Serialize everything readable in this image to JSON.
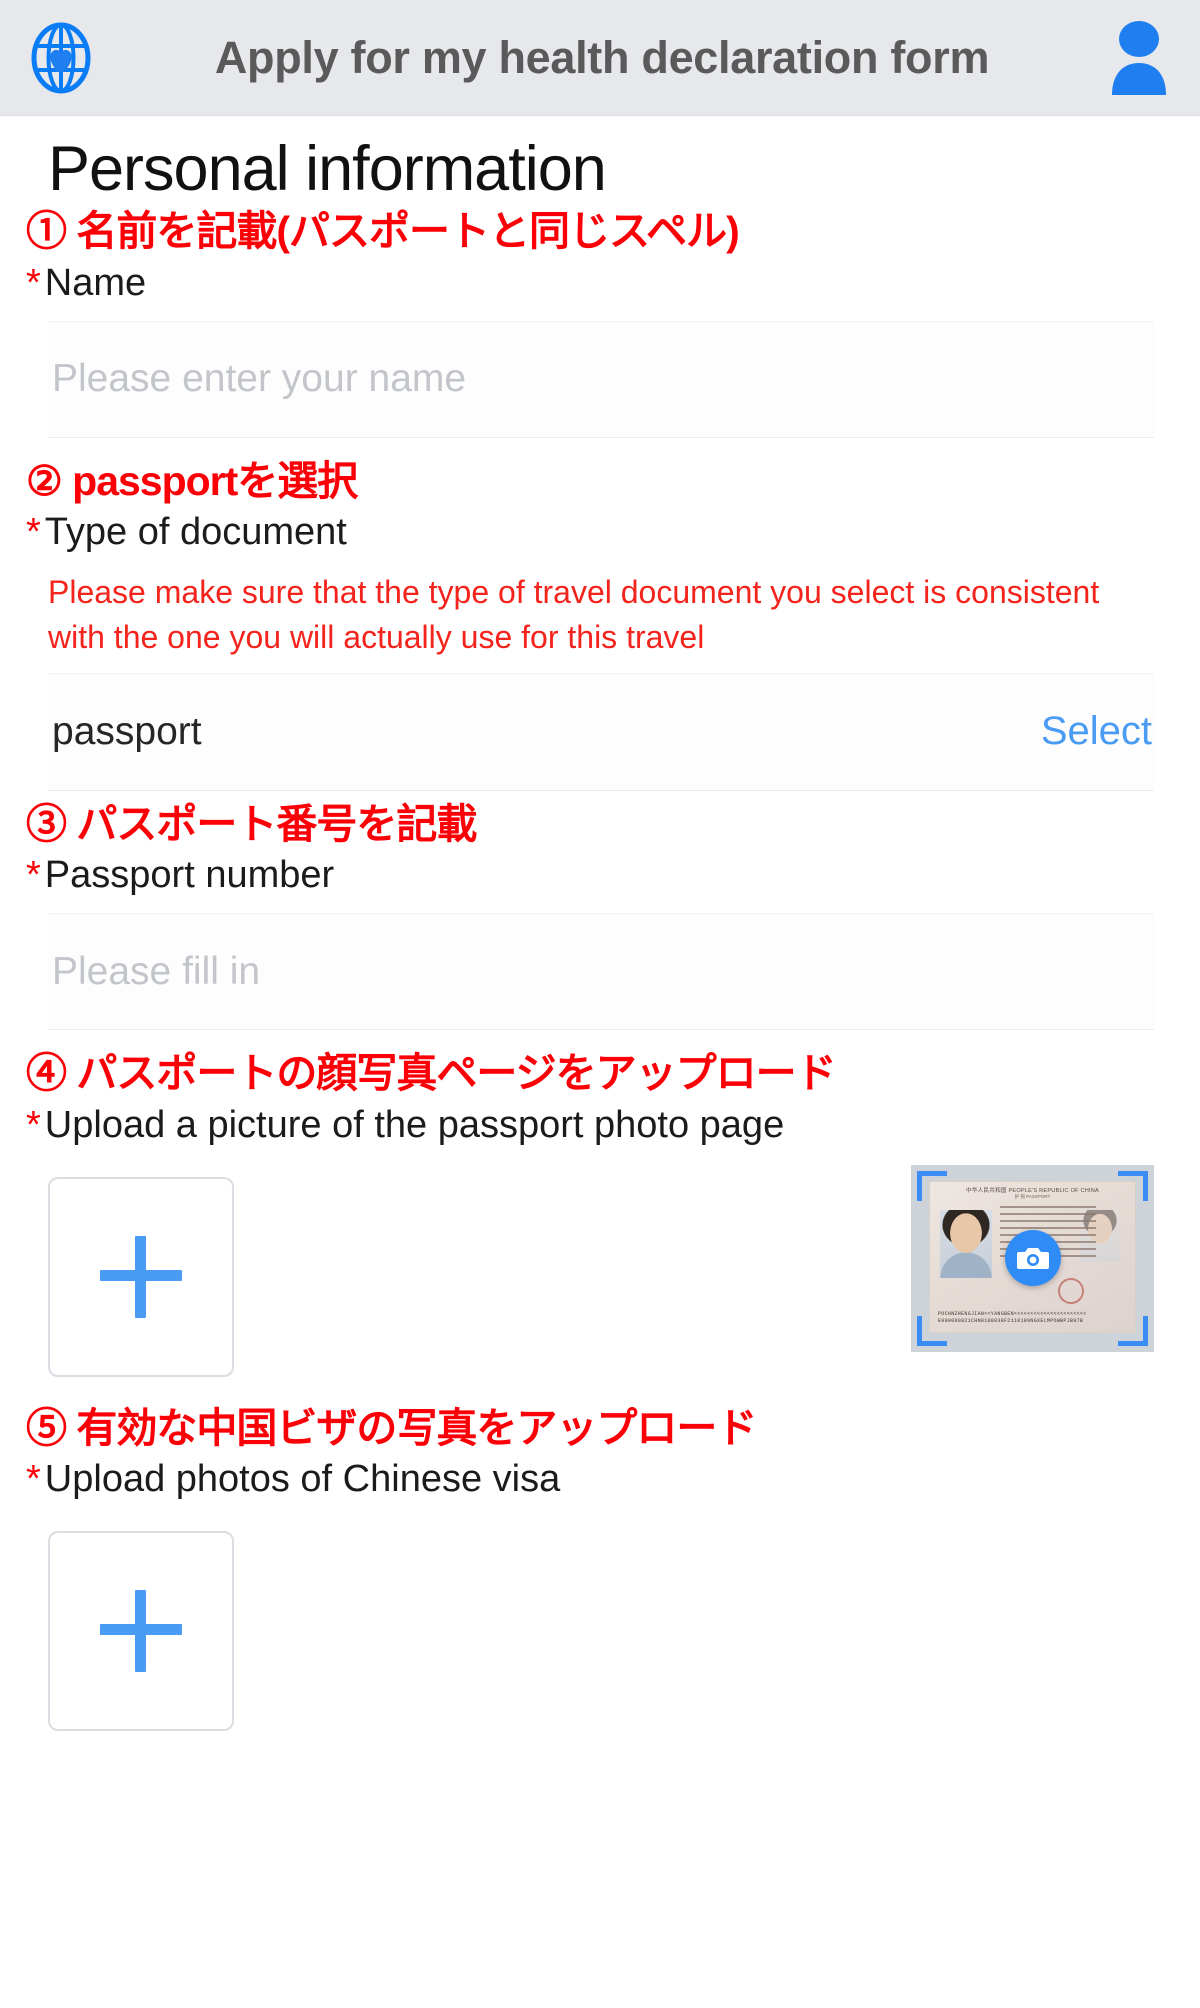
{
  "header": {
    "title": "Apply for my health declaration form",
    "logo_icon": "globe-heart-logo-icon",
    "avatar_icon": "user-avatar-icon"
  },
  "page": {
    "title": "Personal information"
  },
  "sections": {
    "name": {
      "jp_note": "① 名前を記載(パスポートと同じスペル)",
      "required_mark": "*",
      "label": "Name",
      "input_placeholder": "Please enter your name",
      "input_value": ""
    },
    "doc_type": {
      "jp_note": "② passportを選択",
      "required_mark": "*",
      "label": "Type of document",
      "warning": "Please make sure that the type of travel document you select is consistent with the one you will actually use for this travel",
      "selected_value": "passport",
      "select_action": "Select"
    },
    "passport_number": {
      "jp_note": "③ パスポート番号を記載",
      "required_mark": "*",
      "label": "Passport number",
      "input_placeholder": "Please fill in",
      "input_value": ""
    },
    "passport_photo": {
      "jp_note": "④ パスポートの顔写真ページをアップロード",
      "required_mark": "*",
      "label": "Upload a picture of the passport photo page",
      "add_icon": "plus-icon",
      "sample": {
        "card_title": "中华人民共和国  PEOPLE'S REPUBLIC OF CHINA",
        "card_subtitle": "护  照        PASSPORT",
        "mrz_line1": "POCHNZHENGJIAN<<YANGBEN<<<<<<<<<<<<<<<<<<<<<<",
        "mrz_line2": "E900000821CHN8108038F2110189NGXELMPOWBPJB97B",
        "camera_icon": "camera-icon",
        "scan_brackets_icon": "scan-brackets-icon"
      }
    },
    "visa_photo": {
      "jp_note": "⑤ 有効な中国ビザの写真をアップロード",
      "required_mark": "*",
      "label": "Upload photos of Chinese visa",
      "add_icon": "plus-icon"
    }
  },
  "colors": {
    "accent_blue": "#4a9bf3",
    "annotation_red": "#fb0007",
    "warning_red": "#f4231c",
    "header_bg": "#e6e8ec"
  }
}
